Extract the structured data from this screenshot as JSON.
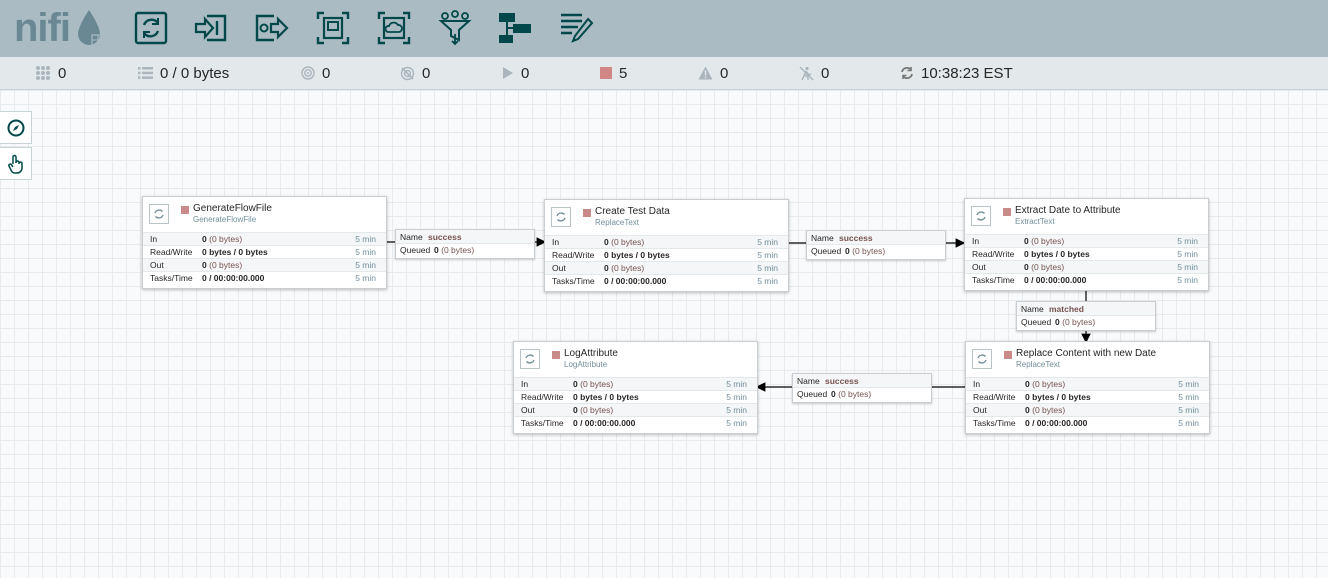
{
  "toolbar": {
    "logo_text": "nifi",
    "buttons": [
      {
        "name": "processor-icon"
      },
      {
        "name": "input-port-icon"
      },
      {
        "name": "output-port-icon"
      },
      {
        "name": "process-group-icon"
      },
      {
        "name": "remote-process-group-icon"
      },
      {
        "name": "funnel-icon"
      },
      {
        "name": "template-icon"
      },
      {
        "name": "label-icon"
      }
    ],
    "accent": "#004849"
  },
  "status": {
    "active_threads": "0",
    "queued": "0 / 0 bytes",
    "transmitting": "0",
    "not_transmitting": "0",
    "running": "0",
    "stopped": "5",
    "invalid": "0",
    "disabled": "0",
    "refreshed": "10:38:23 EST"
  },
  "labels": {
    "in": "In",
    "read_write": "Read/Write",
    "out": "Out",
    "tasks_time": "Tasks/Time",
    "name": "Name",
    "queued": "Queued"
  },
  "processors": [
    {
      "name": "GenerateFlowFile",
      "type": "GenerateFlowFile",
      "in_count": "0",
      "in_bytes": "(0 bytes)",
      "read_write": "0 bytes / 0 bytes",
      "out_count": "0",
      "out_bytes": "(0 bytes)",
      "tasks_time": "0 / 00:00:00.000",
      "window": "5 min"
    },
    {
      "name": "Create Test Data",
      "type": "ReplaceText",
      "in_count": "0",
      "in_bytes": "(0 bytes)",
      "read_write": "0 bytes / 0 bytes",
      "out_count": "0",
      "out_bytes": "(0 bytes)",
      "tasks_time": "0 / 00:00:00.000",
      "window": "5 min"
    },
    {
      "name": "Extract Date to Attribute",
      "type": "ExtractText",
      "in_count": "0",
      "in_bytes": "(0 bytes)",
      "read_write": "0 bytes / 0 bytes",
      "out_count": "0",
      "out_bytes": "(0 bytes)",
      "tasks_time": "0 / 00:00:00.000",
      "window": "5 min"
    },
    {
      "name": "Replace Content with new Date",
      "type": "ReplaceText",
      "in_count": "0",
      "in_bytes": "(0 bytes)",
      "read_write": "0 bytes / 0 bytes",
      "out_count": "0",
      "out_bytes": "(0 bytes)",
      "tasks_time": "0 / 00:00:00.000",
      "window": "5 min"
    },
    {
      "name": "LogAttribute",
      "type": "LogAttribute",
      "in_count": "0",
      "in_bytes": "(0 bytes)",
      "read_write": "0 bytes / 0 bytes",
      "out_count": "0",
      "out_bytes": "(0 bytes)",
      "tasks_time": "0 / 00:00:00.000",
      "window": "5 min"
    }
  ],
  "connections": [
    {
      "relationship": "success",
      "queued_count": "0",
      "queued_bytes": "(0 bytes)"
    },
    {
      "relationship": "success",
      "queued_count": "0",
      "queued_bytes": "(0 bytes)"
    },
    {
      "relationship": "matched",
      "queued_count": "0",
      "queued_bytes": "(0 bytes)"
    },
    {
      "relationship": "success",
      "queued_count": "0",
      "queued_bytes": "(0 bytes)"
    }
  ],
  "colors": {
    "toolbar_bg": "#aabbc3",
    "stopped": "#c98a8a",
    "type_text": "#728e9b",
    "relationship": "#775351"
  }
}
